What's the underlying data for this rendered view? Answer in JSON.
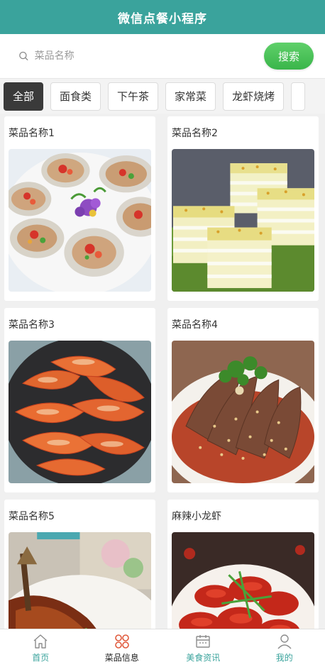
{
  "header": {
    "title": "微信点餐小程序"
  },
  "search": {
    "placeholder": "菜品名称",
    "button_label": "搜索"
  },
  "categories": [
    "全部",
    "面食类",
    "下午茶",
    "家常菜",
    "龙虾烧烤"
  ],
  "dishes": [
    {
      "name": "菜品名称1",
      "photo": "oysters"
    },
    {
      "name": "菜品名称2",
      "photo": "layer-cake"
    },
    {
      "name": "菜品名称3",
      "photo": "shrimp"
    },
    {
      "name": "菜品名称4",
      "photo": "sliced-beef"
    },
    {
      "name": "菜品名称5",
      "photo": "braised-fish"
    },
    {
      "name": "麻辣小龙虾",
      "photo": "crayfish"
    }
  ],
  "tabbar": {
    "items": [
      {
        "label": "首页",
        "icon": "home-icon"
      },
      {
        "label": "菜品信息",
        "icon": "grid-icon",
        "active": true
      },
      {
        "label": "美食资讯",
        "icon": "calendar-icon"
      },
      {
        "label": "我的",
        "icon": "user-icon"
      }
    ]
  },
  "colors": {
    "header": "#3aa39c",
    "search_button": "#4cc35a",
    "active_category": "#3a3a3a"
  }
}
